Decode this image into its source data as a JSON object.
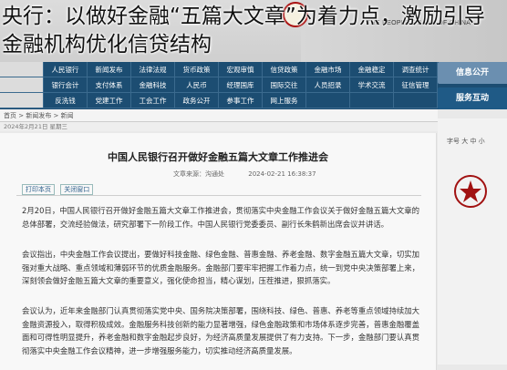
{
  "headline": "央行：以做好金融“五篇大文章”为着力点，激励引导金融机构优化信贷结构",
  "header": {
    "bank_english": "THE PEOPLE'S BANK OF CHINA"
  },
  "nav": {
    "rows": [
      [
        "",
        "人民银行",
        "新闻发布",
        "法律法规",
        "货币政策",
        "宏观审慎",
        "信贷政策",
        "金融市场",
        "金融稳定",
        "调查统计"
      ],
      [
        "",
        "银行会计",
        "支付体系",
        "金融科技",
        "人民币",
        "经理国库",
        "国际交往",
        "人员招录",
        "学术交流",
        "征信管理"
      ],
      [
        "",
        "反洗钱",
        "党建工作",
        "工会工作",
        "政务公开",
        "参事工作",
        "网上服务",
        "",
        "",
        ""
      ]
    ]
  },
  "side_tabs": [
    "信息公开",
    "服务互动"
  ],
  "breadcrumb": "首页 > 新闻发布 > 新闻",
  "date_line": "2024年2月21日 星期三",
  "article": {
    "title": "中国人民银行召开做好金融五篇大文章工作推进会",
    "meta_date": "2024-02-21 16:38:37",
    "meta_source": "文章来源：沟通处",
    "meta_font": "字号 大 中 小",
    "tools": [
      "打印本页",
      "关闭窗口"
    ],
    "paragraphs": [
      "2月20日，中国人民银行召开做好金融五篇大文章工作推进会，贯彻落实中央金融工作会议关于做好金融五篇大文章的总体部署，交流经验做法，研究部署下一阶段工作。中国人民银行党委委员、副行长朱鹤新出席会议并讲话。",
      "会议指出，中央金融工作会议提出，要做好科技金融、绿色金融、普惠金融、养老金融、数字金融五篇大文章，切实加强对重大战略、重点领域和薄弱环节的优质金融服务。金融部门要牢牢把握工作着力点，统一到党中央决策部署上来，深刻领会做好金融五篇大文章的重要意义，强化使命担当，精心谋划，压茬推进，狠抓落实。",
      "会议认为，近年来金融部门认真贯彻落实党中央、国务院决策部署，围绕科技、绿色、普惠、养老等重点领域持续加大金融资源投入，取得积极成效。金融服务科技创新的能力显著增强，绿色金融政策和市场体系逐步完善，普惠金融覆盖面和可得性明显提升，养老金融和数字金融起步良好，为经济高质量发展提供了有力支持。下一步，金融部门要认真贯彻落实中央金融工作会议精神，进一步增强服务能力，切实推动经济高质量发展。"
    ]
  },
  "colors": {
    "nav_bg": "#1c4d72",
    "accent_red": "#a11111"
  }
}
